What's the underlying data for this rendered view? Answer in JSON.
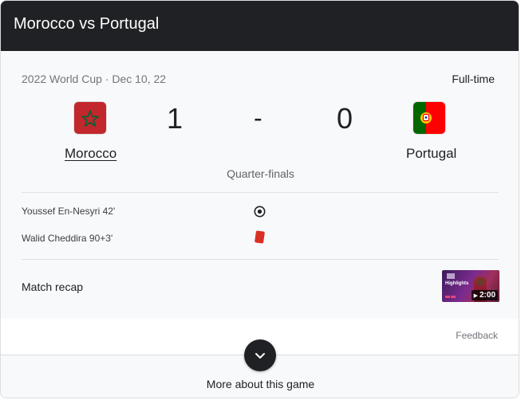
{
  "header": {
    "title": "Morocco vs Portugal"
  },
  "match": {
    "meta": "2022 World Cup · Dec 10, 22",
    "status": "Full-time",
    "stage": "Quarter-finals",
    "home": {
      "name": "Morocco",
      "score": "1",
      "flag_icon": "morocco-flag-icon"
    },
    "away": {
      "name": "Portugal",
      "score": "0",
      "flag_icon": "portugal-flag-icon"
    },
    "separator": "-"
  },
  "events": [
    {
      "text": "Youssef En-Nesyri 42'",
      "icon": "goal-icon"
    },
    {
      "text": "Walid Cheddira 90+3'",
      "icon": "red-card-icon"
    }
  ],
  "recap": {
    "label": "Match recap",
    "thumbnail_text": "Highlights",
    "duration": "2:00"
  },
  "footer": {
    "feedback": "Feedback",
    "more": "More about this game"
  },
  "colors": {
    "header_bg": "#202124",
    "red_card": "#d93025",
    "morocco_red": "#c1272d",
    "morocco_green": "#006233",
    "portugal_green": "#006600",
    "portugal_red": "#ff0000"
  }
}
